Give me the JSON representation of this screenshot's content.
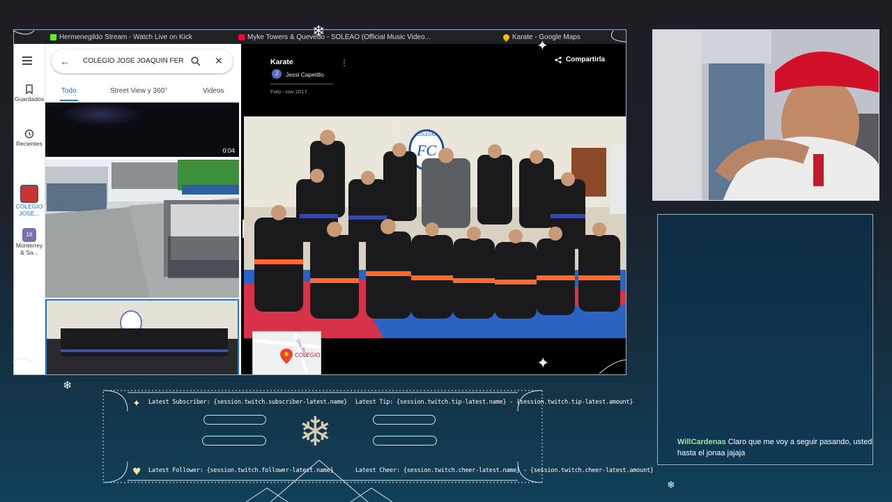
{
  "browser": {
    "tabs": [
      {
        "label": "Hermenegildo Stream - Watch Live on Kick",
        "color": "#53fc18"
      },
      {
        "label": "Myke Towers & Quevedo - SOLEAO (Official Music Video...",
        "color": "#ff0033"
      },
      {
        "label": "Karate - Google Maps",
        "color": "#fbbc04"
      }
    ]
  },
  "maps": {
    "rail": {
      "saved_label": "Guardados",
      "recent_label": "Recientes",
      "place1_label": "COLEGIO JOSE...",
      "place2_label": "Monterrey & Sa...",
      "place2_badge": "16"
    },
    "search_value": "COLEGIO JOSE JOAQUIN FER",
    "tabs": [
      {
        "label": "Todo"
      },
      {
        "label": "Street View y 360°"
      },
      {
        "label": "Videos"
      }
    ],
    "video_duration": "0:04"
  },
  "viewer": {
    "title": "Karate",
    "author": "Jessi Capetillo",
    "author_initial": "J",
    "date": "Foto - nov 2017",
    "share_label": "Compartirla",
    "minimap_label": "COLEGIO JOAQUIN",
    "minimap_street": "Dios Peza",
    "photo_sign_letters": "FC",
    "photo_sign_text": "COLEGIO"
  },
  "chat": {
    "username": "WillCardenas",
    "username_color": "#9be3a6",
    "message_line1": "Claro que me voy a seguir pasando, usted",
    "message_line2": "hasta el jonaa jajaja"
  },
  "alerts": {
    "latest_subscriber": "Latest Subscriber: {session.twitch.subscriber-latest.name}",
    "latest_tip": "Latest Tip: {session.twitch.tip-latest.name} - {session.twitch.tip-latest.amount}",
    "latest_follower": "Latest Follower: {session.twitch.follower-latest.name}",
    "latest_cheer": "Latest Cheer: {session.twitch.cheer-latest.name} - {session.twitch.cheer-latest.amount}"
  },
  "colors": {
    "accent": "#1a73e8",
    "frame": "#c9d7e3"
  }
}
